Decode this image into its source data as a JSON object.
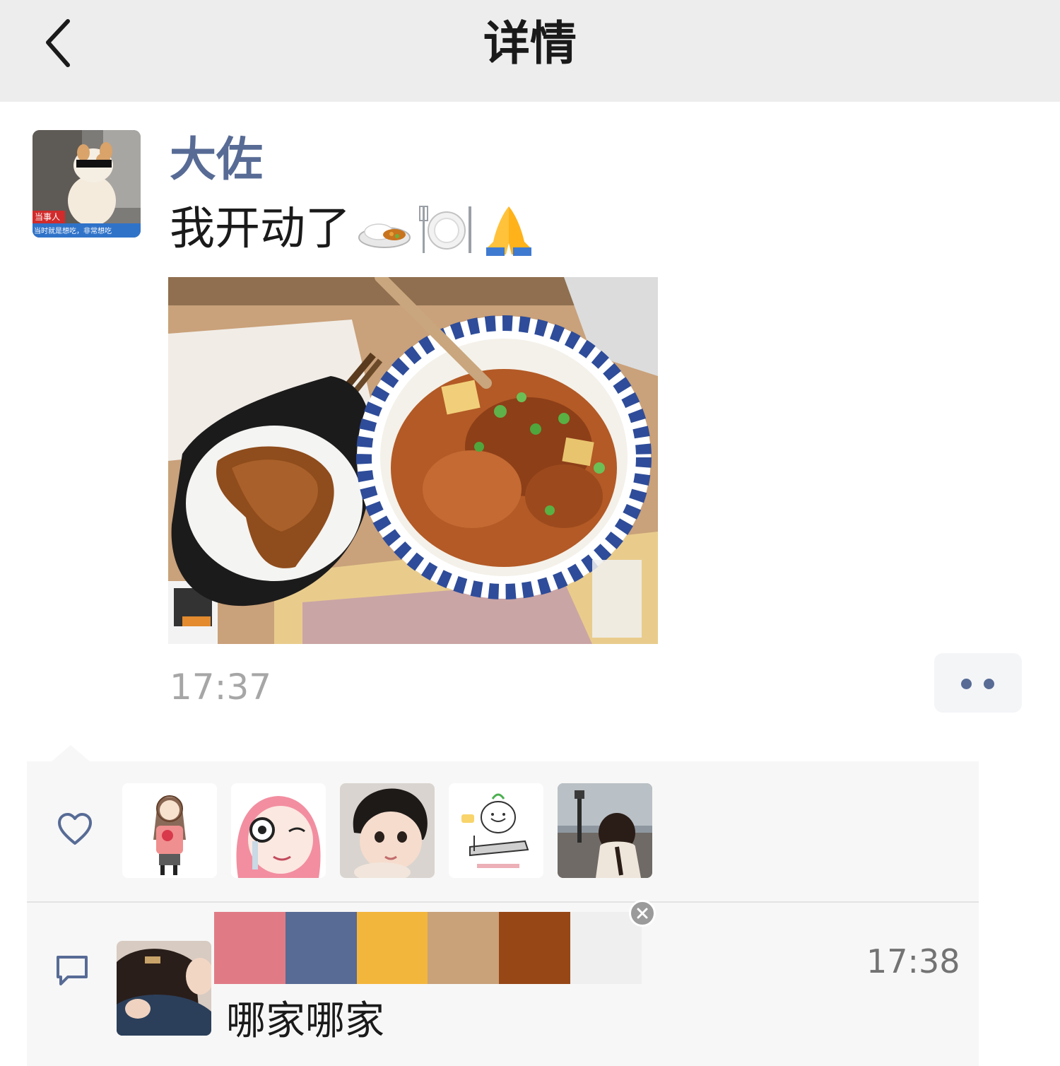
{
  "header": {
    "title": "详情"
  },
  "post": {
    "author": "大佐",
    "text": "我开动了",
    "emojis": [
      "curry-rice-emoji",
      "fork-knife-plate-emoji",
      "folded-hands-emoji"
    ],
    "avatar_caption": {
      "tag": "当事人",
      "line": "当时就是想吃，非常想吃"
    },
    "time": "17:37"
  },
  "likes": {
    "avatars": [
      "illustrated-girl-holding-flowers",
      "pink-hair-girl-with-magnifier",
      "baby-photo",
      "cartoon-treadmill-sticker",
      "girl-back-view-photo"
    ]
  },
  "comment": {
    "time": "17:38",
    "text": "哪家哪家",
    "palette_colors": [
      "#e07b85",
      "#576b95",
      "#f3b63c",
      "#c9a27a",
      "#974716",
      "#efefef"
    ]
  },
  "colors": {
    "link_blue": "#576b95",
    "header_bg": "#ededed",
    "panel_bg": "#f7f7f7",
    "meta_gray": "#a6a6a6"
  }
}
